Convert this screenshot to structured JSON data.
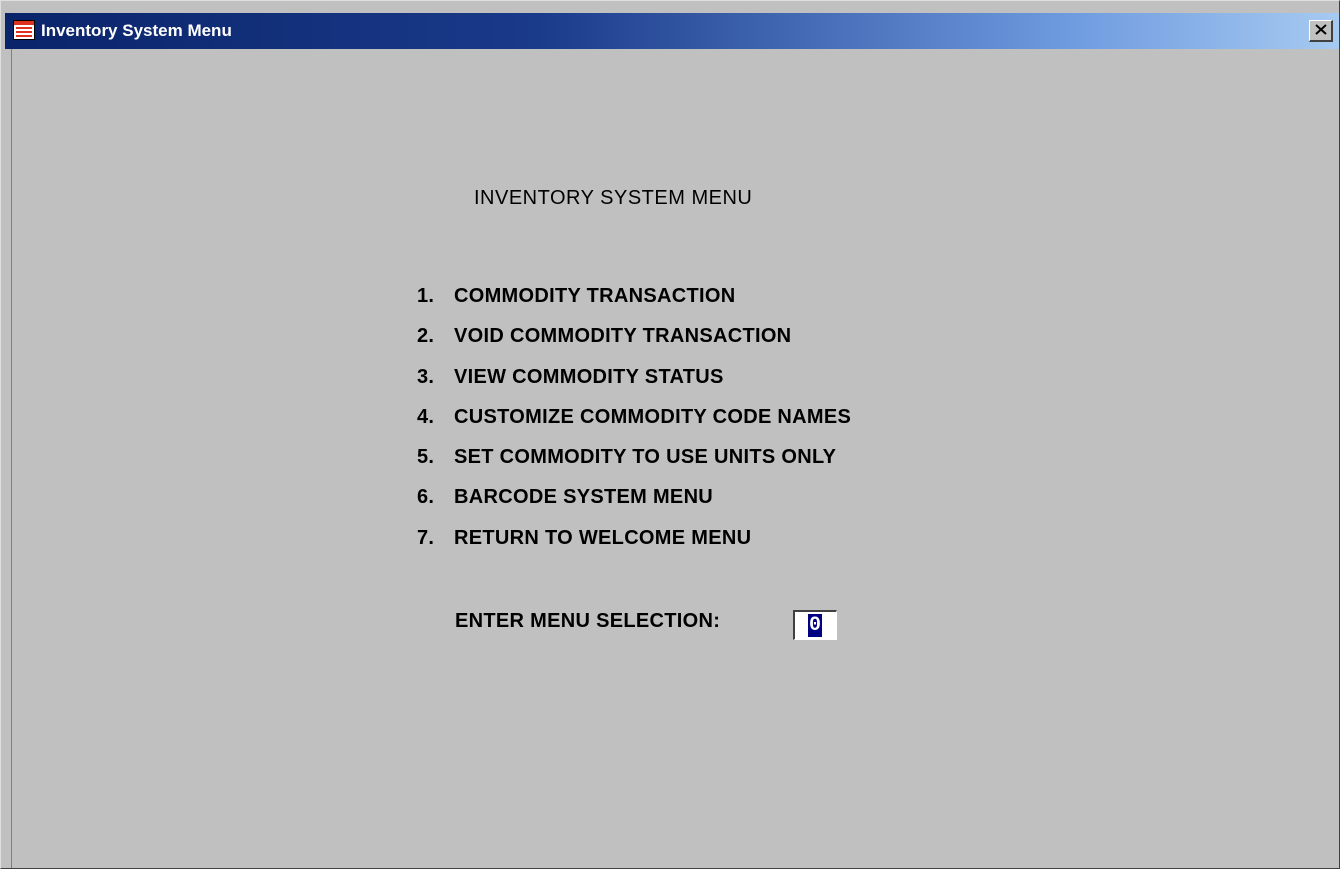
{
  "window": {
    "title": "Inventory System Menu",
    "icon": "form-window-icon",
    "close_icon": "close-icon"
  },
  "colors": {
    "titlebar_start": "#0a246a",
    "titlebar_end": "#a6caf0",
    "window_bg": "#c0c0c0",
    "selection_bg": "#000080"
  },
  "menu": {
    "heading": "INVENTORY SYSTEM MENU",
    "items": [
      {
        "number": "1.",
        "label": "COMMODITY TRANSACTION"
      },
      {
        "number": "2.",
        "label": "VOID COMMODITY TRANSACTION"
      },
      {
        "number": "3.",
        "label": "VIEW COMMODITY STATUS"
      },
      {
        "number": "4.",
        "label": "CUSTOMIZE COMMODITY CODE NAMES"
      },
      {
        "number": "5.",
        "label": "SET COMMODITY TO USE UNITS ONLY"
      },
      {
        "number": "6.",
        "label": "BARCODE SYSTEM MENU"
      },
      {
        "number": "7.",
        "label": "RETURN TO WELCOME MENU"
      }
    ],
    "prompt_label": "ENTER MENU SELECTION:",
    "selection_value": "0"
  }
}
